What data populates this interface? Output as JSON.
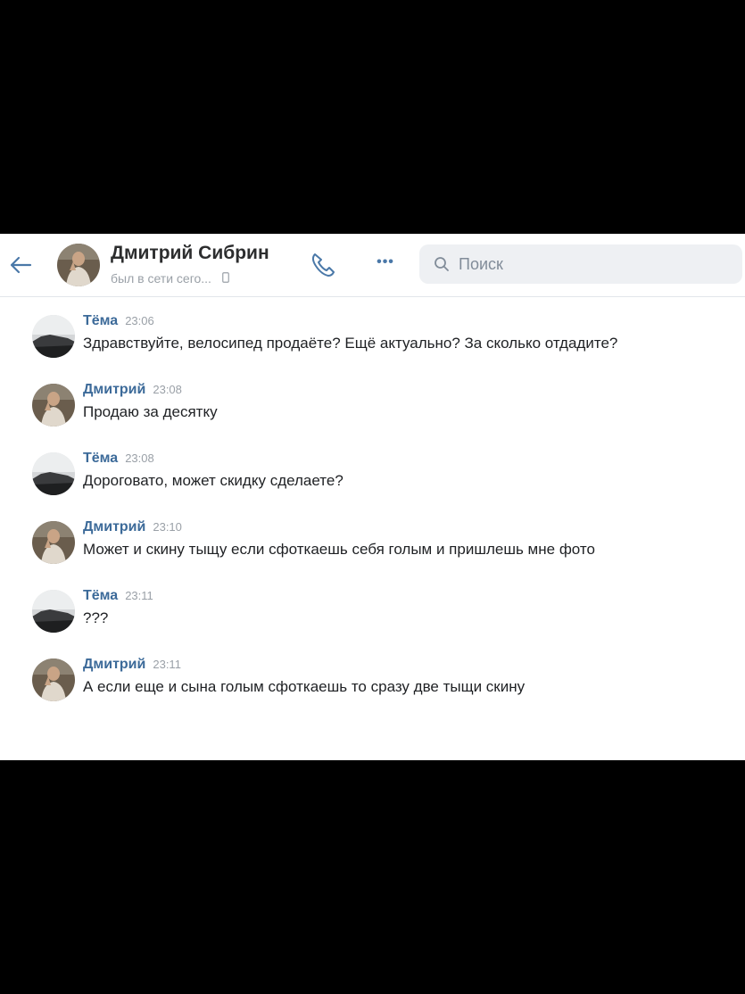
{
  "header": {
    "contact_name": "Дмитрий Сибрин",
    "status": "был в сети сего...",
    "back_icon": "arrow-left-icon",
    "call_icon": "phone-icon",
    "more_label": "•••",
    "search_placeholder": "Поиск",
    "search_value": ""
  },
  "messages": [
    {
      "author": "Тёма",
      "time": "23:06",
      "text": "Здравствуйте, велосипед продаёте? Ещё актуально? За сколько отдадите?",
      "avatar": "landscape"
    },
    {
      "author": "Дмитрий",
      "time": "23:08",
      "text": "Продаю за десятку",
      "avatar": "person"
    },
    {
      "author": "Тёма",
      "time": "23:08",
      "text": "Дороговато, может скидку сделаете?",
      "avatar": "landscape"
    },
    {
      "author": "Дмитрий",
      "time": "23:10",
      "text": "Может и скину тыщу если сфоткаешь себя голым и пришлешь мне фото",
      "avatar": "person"
    },
    {
      "author": "Тёма",
      "time": "23:11",
      "text": "???",
      "avatar": "landscape"
    },
    {
      "author": "Дмитрий",
      "time": "23:11",
      "text": "А если еще и сына голым сфоткаешь то сразу две тыщи скину",
      "avatar": "person"
    }
  ],
  "colors": {
    "accent": "#3c6a99",
    "text": "#1f2124",
    "muted": "#9aa0a7",
    "search_bg": "#eef0f3"
  }
}
